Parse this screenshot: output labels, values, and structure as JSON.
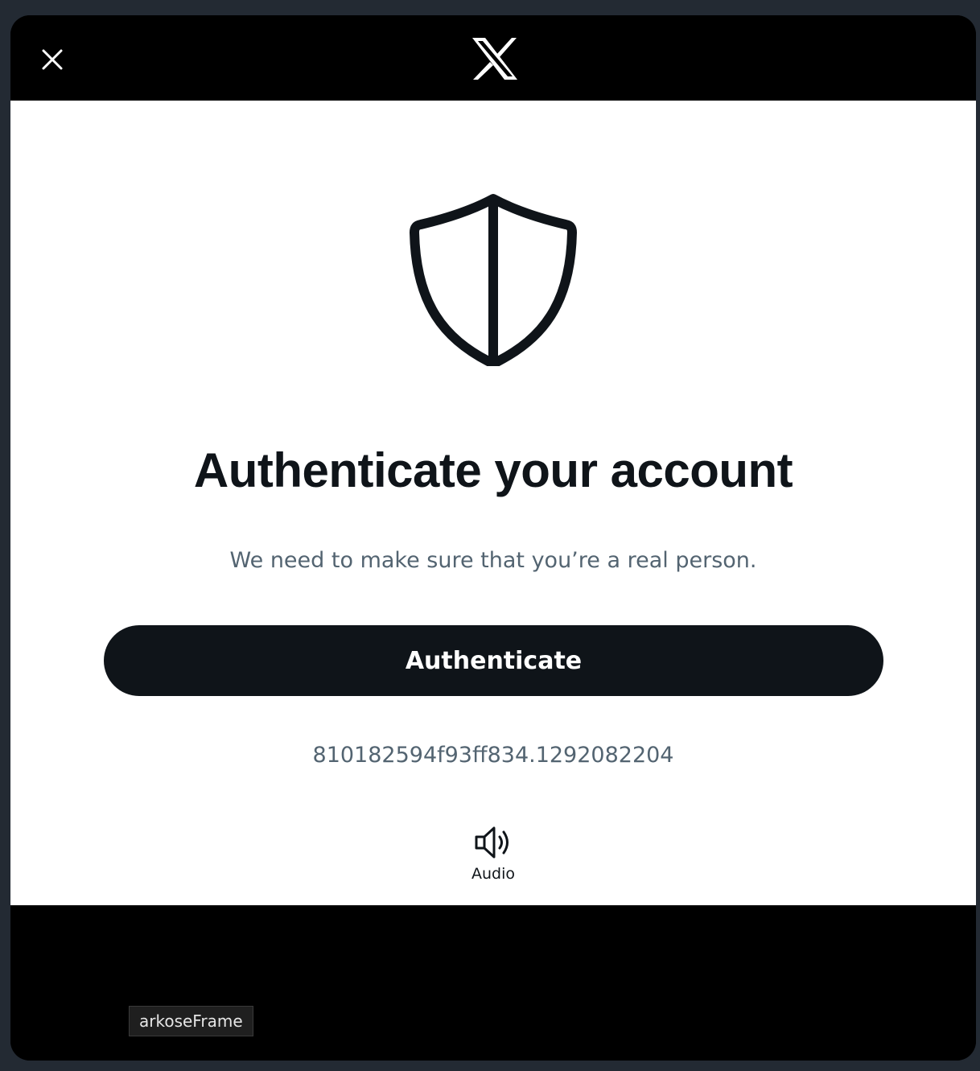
{
  "dialog": {
    "close_icon": "close-icon",
    "logo_icon": "x-logo-icon"
  },
  "main": {
    "shield_icon": "shield-icon",
    "title": "Authenticate your account",
    "subtitle": "We need to make sure that you’re a real person.",
    "authenticate_label": "Authenticate",
    "session_id": "810182594f93ff834.1292082204",
    "audio_icon": "speaker-icon",
    "audio_label": "Audio"
  },
  "overlay": {
    "frame_tag": "arkoseFrame"
  },
  "colors": {
    "background": "#232a33",
    "dialog": "#000000",
    "content": "#ffffff",
    "primary_text": "#0f1419",
    "secondary_text": "#536471",
    "button_bg": "#0f1419",
    "button_text": "#ffffff"
  }
}
